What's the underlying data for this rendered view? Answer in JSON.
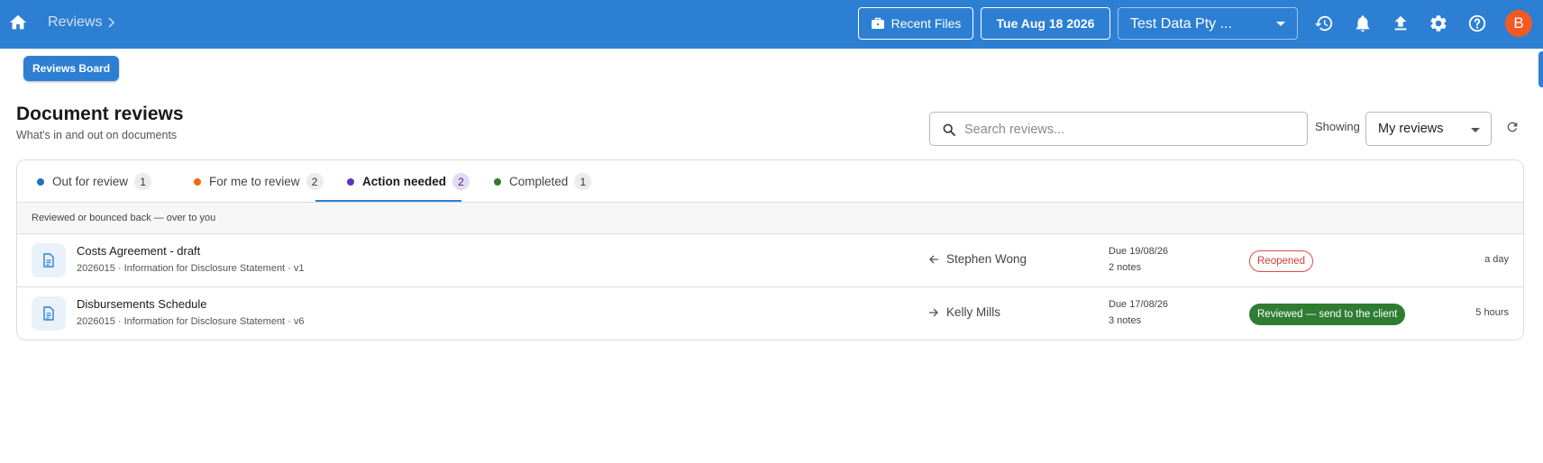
{
  "topbar": {
    "breadcrumb": "Reviews",
    "recent_files_label": "Recent Files",
    "date_label": "Tue Aug 18 2026",
    "company_selected": "Test Data Pty ...",
    "avatar_letter": "B",
    "bar_color": "#2d7fd3",
    "avatar_color": "#f25a22",
    "icons": [
      "home-icon",
      "chevron-right-icon",
      "briefcase-icon",
      "history-icon",
      "bell-icon",
      "upload-icon",
      "gear-icon",
      "help-icon"
    ]
  },
  "board_button_label": "Reviews Board",
  "page": {
    "title": "Document reviews",
    "subtitle": "What's in and out on documents"
  },
  "search": {
    "placeholder": "Search reviews..."
  },
  "filter": {
    "showing_label": "Showing",
    "selected": "My reviews"
  },
  "tabs": [
    {
      "label": "Out for review",
      "count": "1",
      "dot_color": "#1a73c8"
    },
    {
      "label": "For me to review",
      "count": "2",
      "dot_color": "#ef6c00"
    },
    {
      "label": "Action needed",
      "count": "2",
      "dot_color": "#5e35b1",
      "active": true
    },
    {
      "label": "Completed",
      "count": "1",
      "dot_color": "#2e7d32"
    }
  ],
  "hint_text": "Reviewed or bounced back — over to you",
  "rows": [
    {
      "title": "Costs Agreement - draft",
      "meta": "2026015 · Information for Disclosure Statement · v1",
      "direction_icon": "arrow-left-icon",
      "person": "Stephen Wong",
      "due": "Due 19/08/26",
      "notes": "2 notes",
      "status": "Reopened",
      "age": "a day"
    },
    {
      "title": "Disbursements Schedule",
      "meta": "2026015 · Information for Disclosure Statement · v6",
      "direction_icon": "arrow-right-icon",
      "person": "Kelly Mills",
      "due": "Due 17/08/26",
      "notes": "3 notes",
      "status": "Reviewed — send to the client",
      "age": "5 hours"
    }
  ]
}
